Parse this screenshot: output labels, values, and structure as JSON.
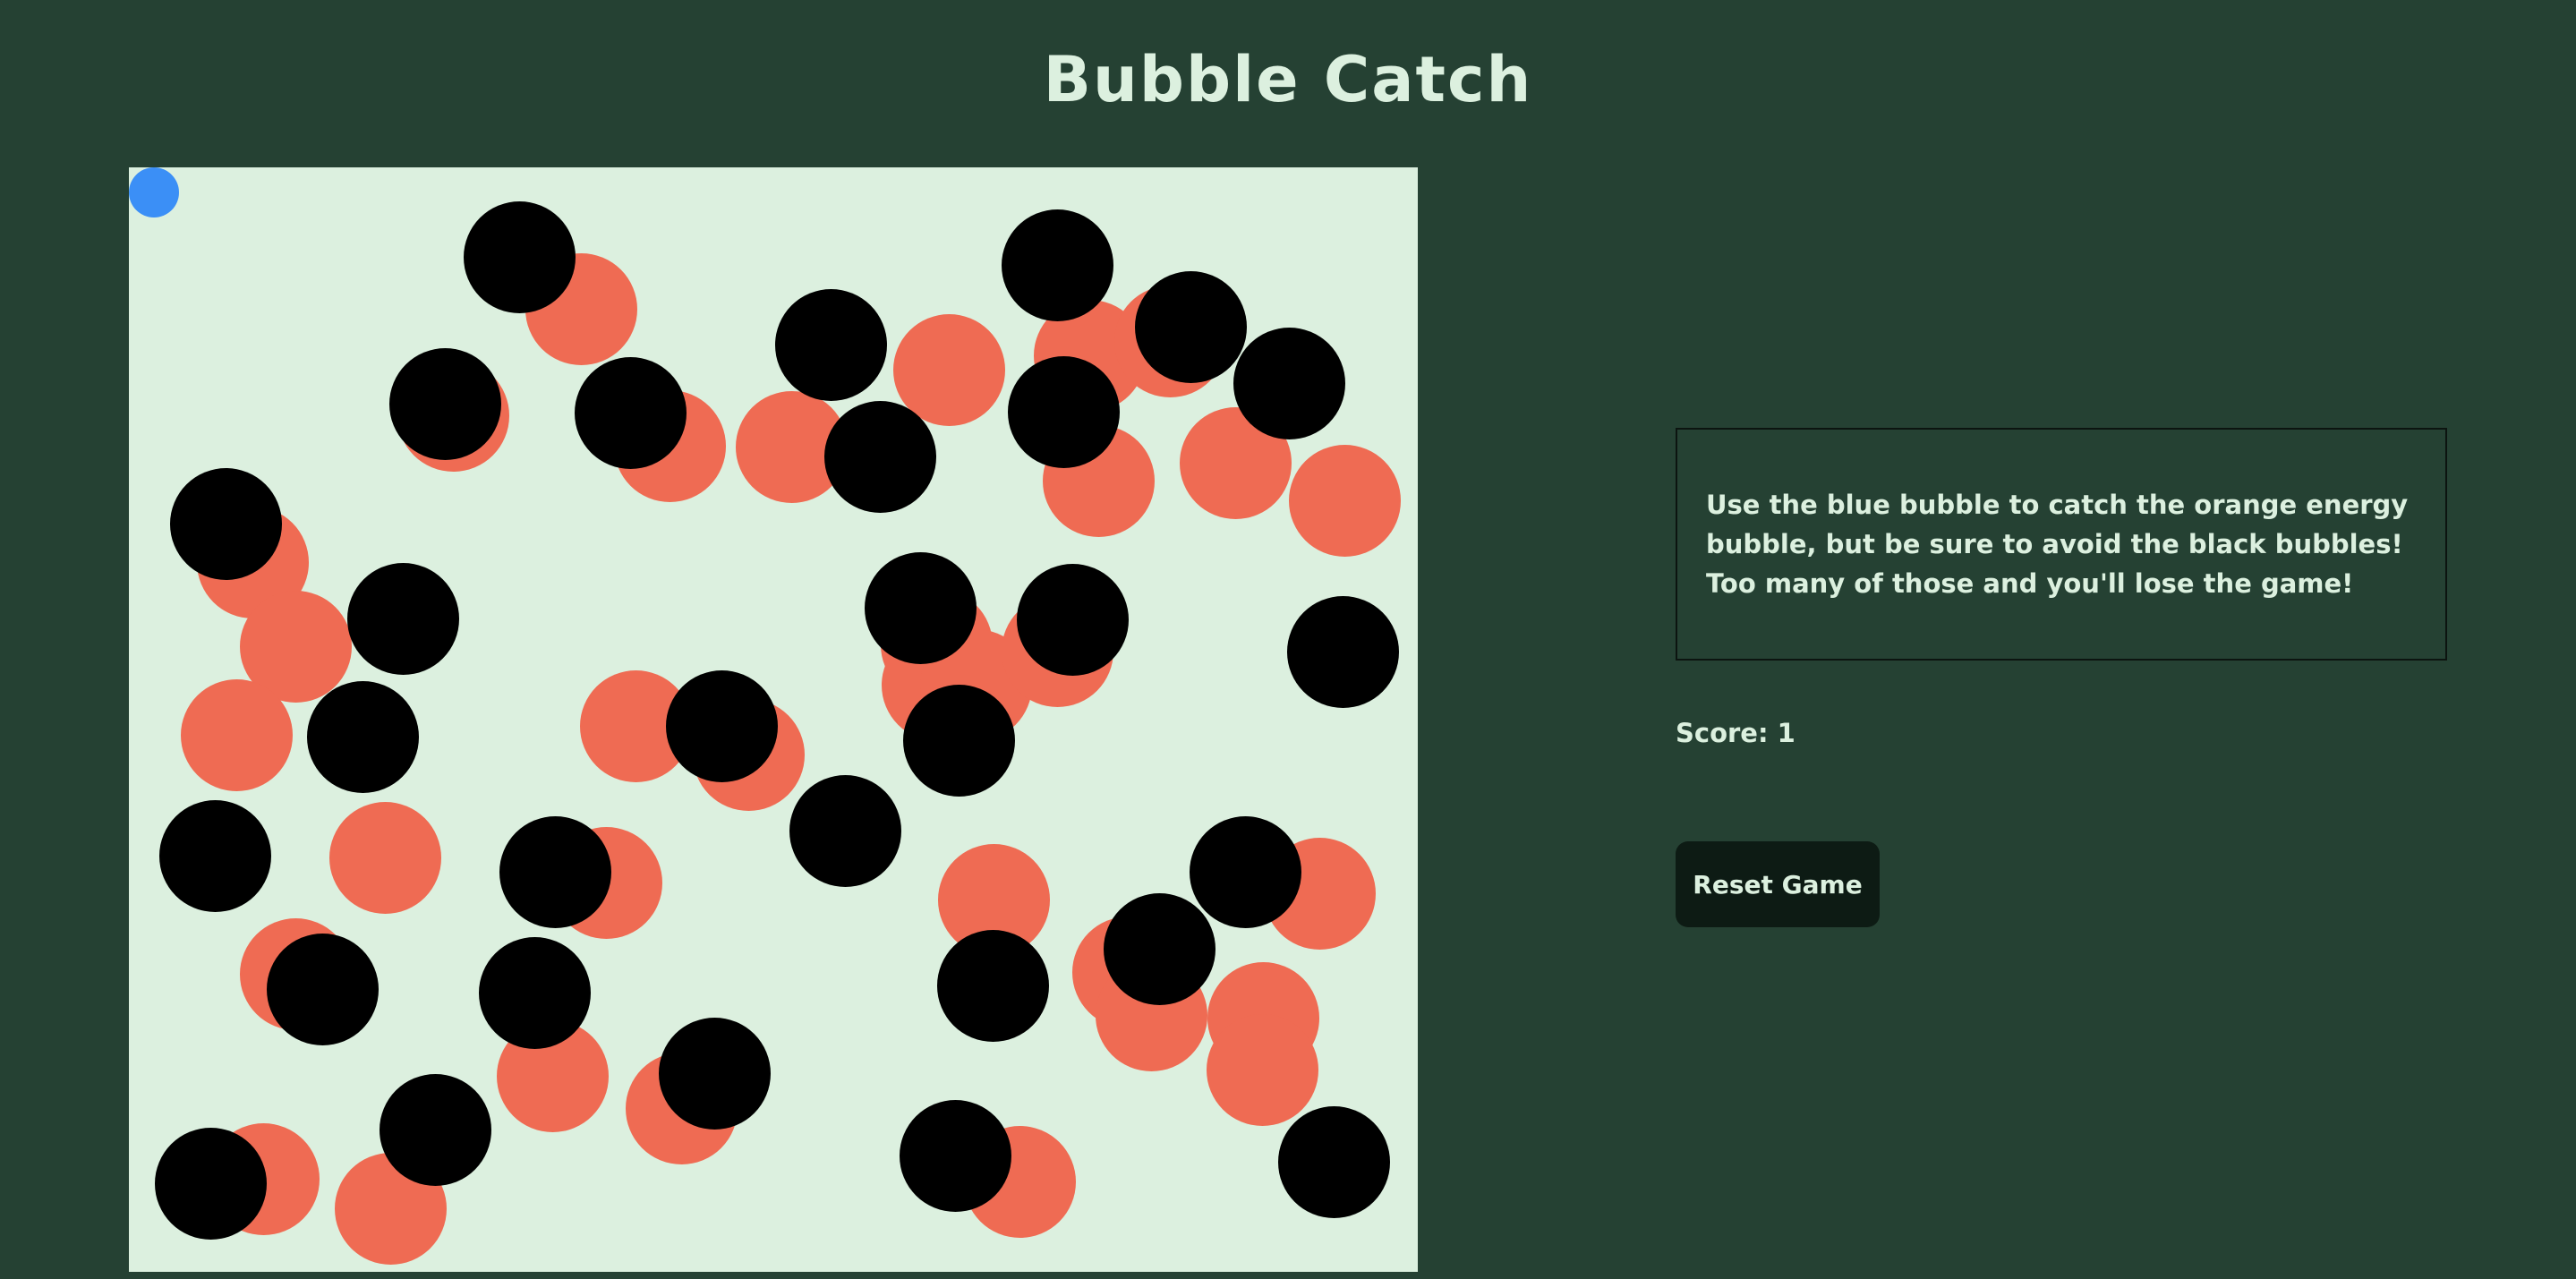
{
  "title": "Bubble Catch",
  "instructions": "Use the blue bubble to catch the orange energy bubble, but be sure to avoid the black bubbles! Too many of those and you'll lose the game!",
  "score_text": "Score: 1",
  "reset_label": "Reset Game",
  "colors": {
    "background": "#254133",
    "board": "#dcf0df",
    "player": "#3b8ff6",
    "energy": "#ef6b53",
    "enemy": "#000000",
    "text": "#dcf0df"
  },
  "icons": {
    "player": "blue-bubble",
    "energy": "orange-bubble",
    "enemy": "black-bubble"
  }
}
